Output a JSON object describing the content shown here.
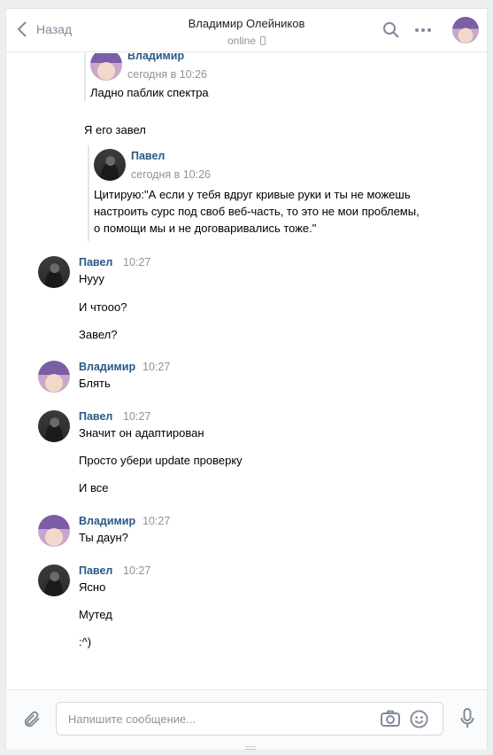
{
  "header": {
    "back_label": "Назад",
    "title": "Владимир Олейников",
    "status": "online"
  },
  "history": {
    "forward_1": {
      "author": "Владимир",
      "time": "сегодня в 10:26",
      "text": "Ладно паблик спектра"
    },
    "plain_1": "Я его завел",
    "forward_2": {
      "author": "Павел",
      "time": "сегодня в 10:26",
      "lines": [
        "Цитирую:\"А если у тебя вдруг кривые руки и ты не можешь",
        "настроить сурс под своб веб-часть, то это не мои проблемы,",
        "о помощи мы и не договаривались тоже.\""
      ]
    },
    "messages": [
      {
        "author": "Павел",
        "time": "10:27",
        "lines": [
          "Нууу",
          "И чтооо?",
          "Завел?"
        ]
      },
      {
        "author": "Владимир",
        "time": "10:27",
        "lines": [
          "Блять"
        ]
      },
      {
        "author": "Павел",
        "time": "10:27",
        "lines": [
          "Значит он адаптирован",
          "Просто убери update проверку",
          "И все"
        ]
      },
      {
        "author": "Владимир",
        "time": "10:27",
        "lines": [
          "Ты даун?"
        ]
      },
      {
        "author": "Павел",
        "time": "10:27",
        "lines": [
          "Ясно",
          "Мутед",
          ":^)"
        ]
      }
    ]
  },
  "composer": {
    "placeholder": "Напишите сообщение..."
  },
  "icons": {
    "back": "chevron-left-icon",
    "search": "search-icon",
    "more": "more-horizontal-icon",
    "attach": "paperclip-icon",
    "camera": "camera-icon",
    "smile": "smile-icon",
    "mic": "microphone-icon"
  },
  "colors": {
    "link": "#2a5885",
    "muted": "#939393",
    "icon": "#828a99",
    "background": "#edeef0"
  }
}
